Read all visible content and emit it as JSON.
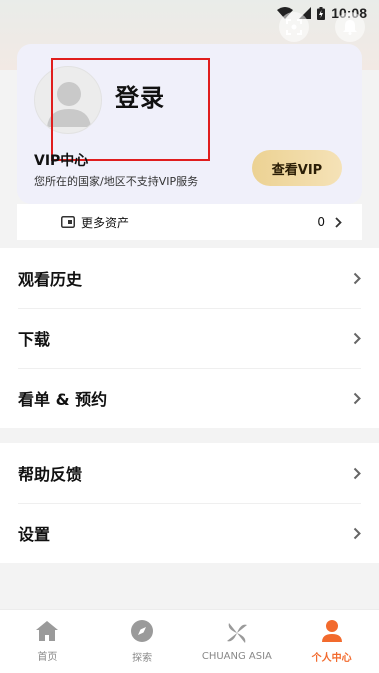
{
  "status_bar": {
    "time": "10:08"
  },
  "profile": {
    "login_label": "登录",
    "vip_title": "VIP中心",
    "vip_desc": "您所在的国家/地区不支持VIP服务",
    "vip_button": "查看VIP"
  },
  "assets": {
    "label": "更多资产",
    "count": "0"
  },
  "menu": {
    "group1": [
      {
        "label": "观看历史"
      },
      {
        "label": "下载"
      },
      {
        "label": "看单 & 预约"
      }
    ],
    "group2": [
      {
        "label": "帮助反馈"
      },
      {
        "label": "设置"
      }
    ]
  },
  "bottom_nav": [
    {
      "label": "首页",
      "icon": "home-icon"
    },
    {
      "label": "探索",
      "icon": "compass-icon"
    },
    {
      "label": "CHUANG ASIA",
      "icon": "pinwheel-icon"
    },
    {
      "label": "个人中心",
      "icon": "person-icon",
      "active": true
    }
  ],
  "colors": {
    "accent": "#f26a2d",
    "vip_gold": "#ecd293",
    "card_bg": "#f0f0fa"
  }
}
